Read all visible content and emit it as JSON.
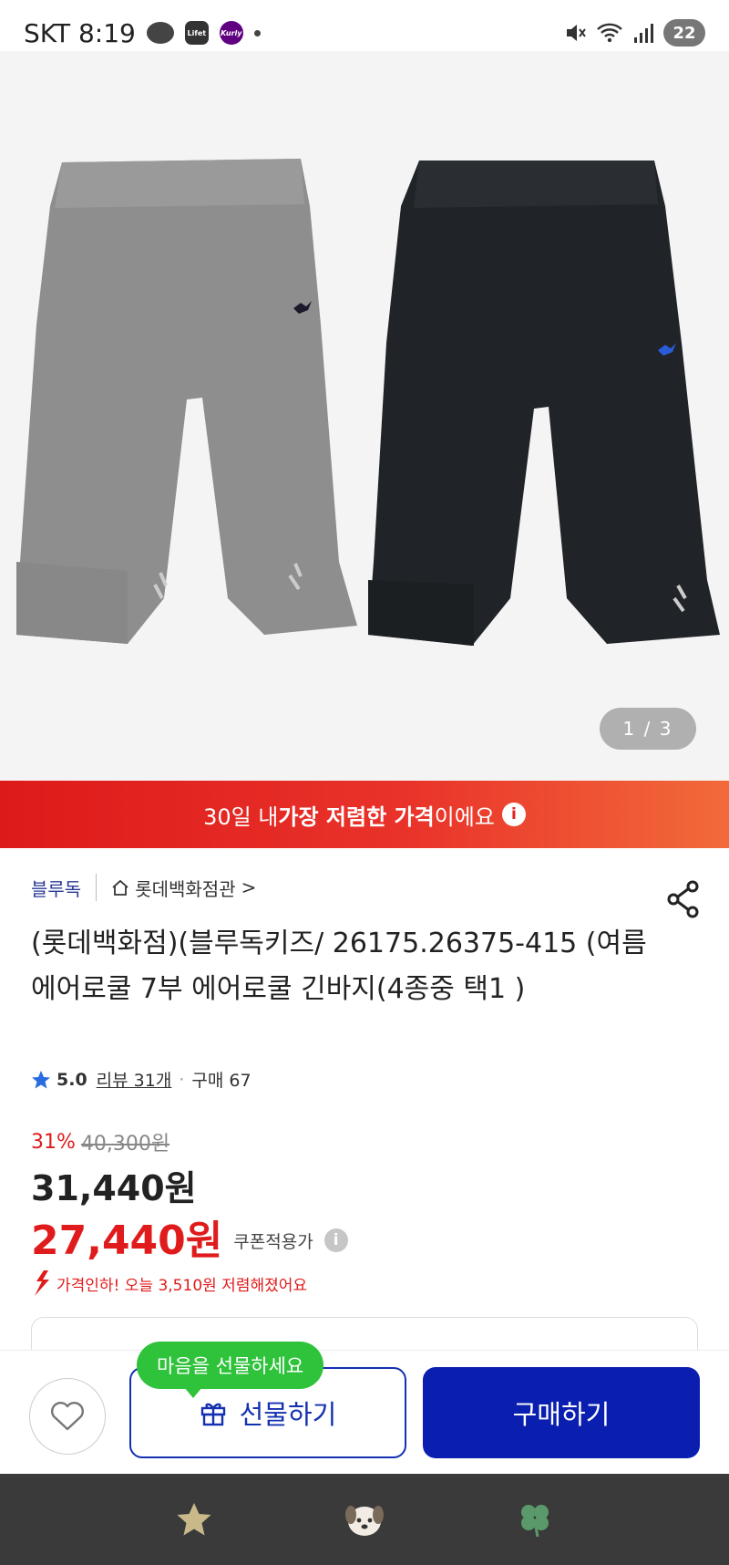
{
  "status_bar": {
    "carrier_time": "SKT 8:19",
    "chip_lifet": "Lifet",
    "chip_kurly": "Kurly",
    "battery": "22"
  },
  "gallery": {
    "counter": "1 / 3"
  },
  "banner": {
    "prefix": "30일 내 ",
    "highlight": "가장 저렴한 가격",
    "suffix": "이에요",
    "info_glyph": "i"
  },
  "product": {
    "brand": "블루독",
    "store": "롯데백화점관",
    "store_chevron": ">",
    "title": "(롯데백화점)(블루독키즈/ 26175.26375-415 (여름 에어로쿨 7부 에어로쿨 긴바지(4종중 택1 )",
    "rating": "5.0",
    "review": "리뷰 31개",
    "purchases": "구매 67",
    "sep": "·"
  },
  "pricing": {
    "discount_rate": "31%",
    "original_price": "40,300원",
    "price": "31,440원",
    "coupon_price": "27,440원",
    "coupon_label": "쿠폰적용가",
    "coupon_info": "i",
    "price_drop": "가격인하! 오늘 3,510원 저렴해졌어요"
  },
  "actions": {
    "gift_tooltip": "마음을 선물하세요",
    "gift_label": "선물하기",
    "buy_label": "구매하기"
  },
  "colors": {
    "accent_blue": "#0a1fb0",
    "sale_red": "#e01b1b",
    "tooltip_green": "#2fc23b"
  }
}
